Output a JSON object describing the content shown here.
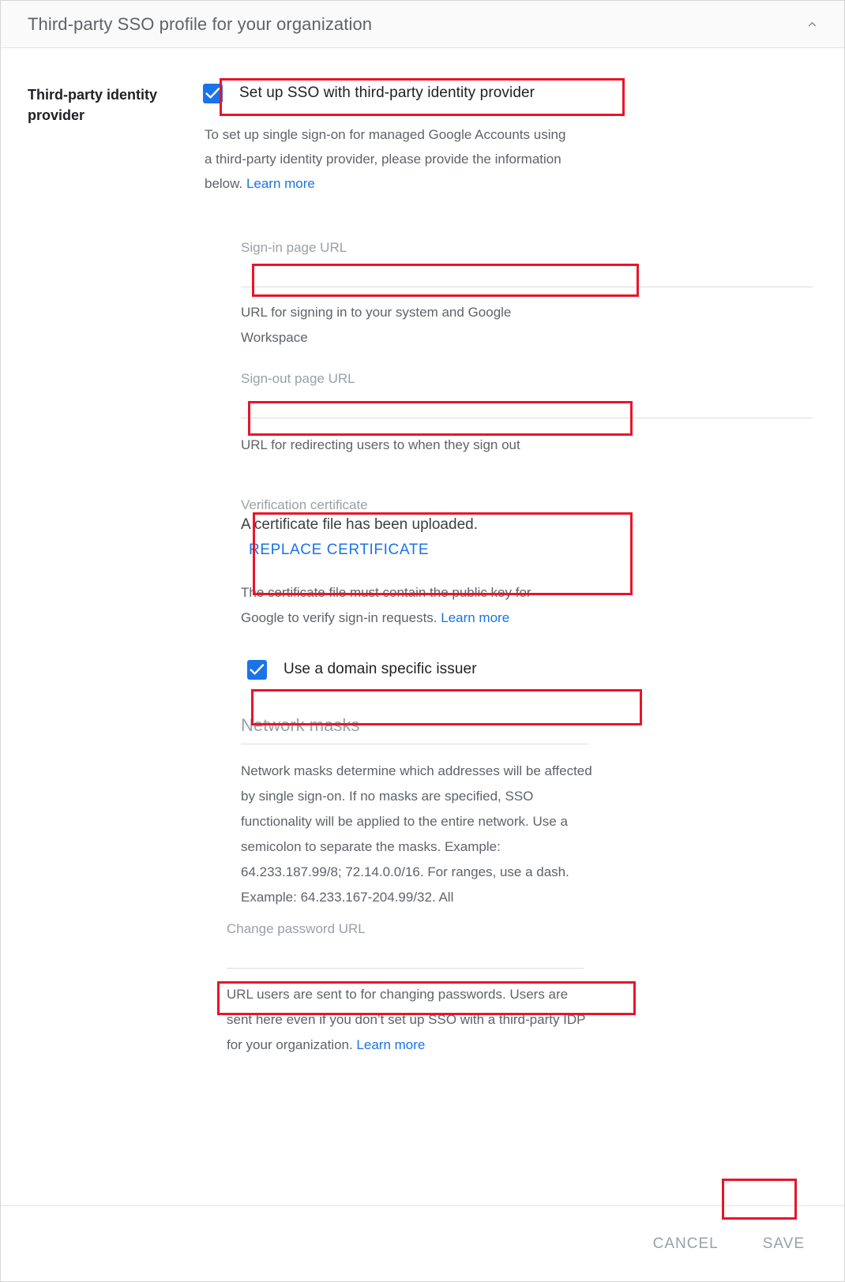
{
  "header": {
    "title": "Third-party SSO profile for your organization",
    "collapse_icon": "chevron-up-icon"
  },
  "section": {
    "left_label": "Third-party identity provider"
  },
  "sso_checkbox": {
    "label": "Set up SSO with third-party identity provider",
    "checked": true
  },
  "intro": {
    "text": "To set up single sign-on for managed Google Accounts using a third-party identity provider, please provide the information below. ",
    "learn_more": "Learn more"
  },
  "fields": {
    "signin": {
      "label": "Sign-in page URL",
      "value": "",
      "placeholder": "",
      "help": "URL for signing in to your system and Google Workspace"
    },
    "signout": {
      "label": "Sign-out page URL",
      "value": "",
      "placeholder": "",
      "help": "URL for redirecting users to when they sign out"
    },
    "change_password": {
      "label": "Change password URL",
      "value": "",
      "placeholder": "",
      "help": "URL users are sent to for changing passwords. Users are sent here even if you don’t set up SSO with a third-party IDP for your organization. ",
      "learn_more": "Learn more"
    }
  },
  "certificate": {
    "label": "Verification certificate",
    "status": "A certificate file has been uploaded.",
    "replace_button": "REPLACE CERTIFICATE",
    "help": "The certificate file must contain the public key for Google to verify sign-in requests. ",
    "learn_more": "Learn more"
  },
  "domain_issuer_checkbox": {
    "label": "Use a domain specific issuer",
    "checked": true
  },
  "network_masks": {
    "heading": "Network masks",
    "description": "Network masks determine which addresses will be affected by single sign-on. If no masks are specified, SSO functionality will be applied to the entire network. Use a semicolon to separate the masks. Example: 64.233.187.99/8; 72.14.0.0/16. For ranges, use a dash. Example: 64.233.167-204.99/32. All"
  },
  "footer": {
    "cancel_label": "CANCEL",
    "save_label": "SAVE"
  },
  "colors": {
    "accent": "#1a73e8",
    "annotation": "#e8152a",
    "muted_text": "#5f6368",
    "label_text": "#9aa0a6"
  }
}
